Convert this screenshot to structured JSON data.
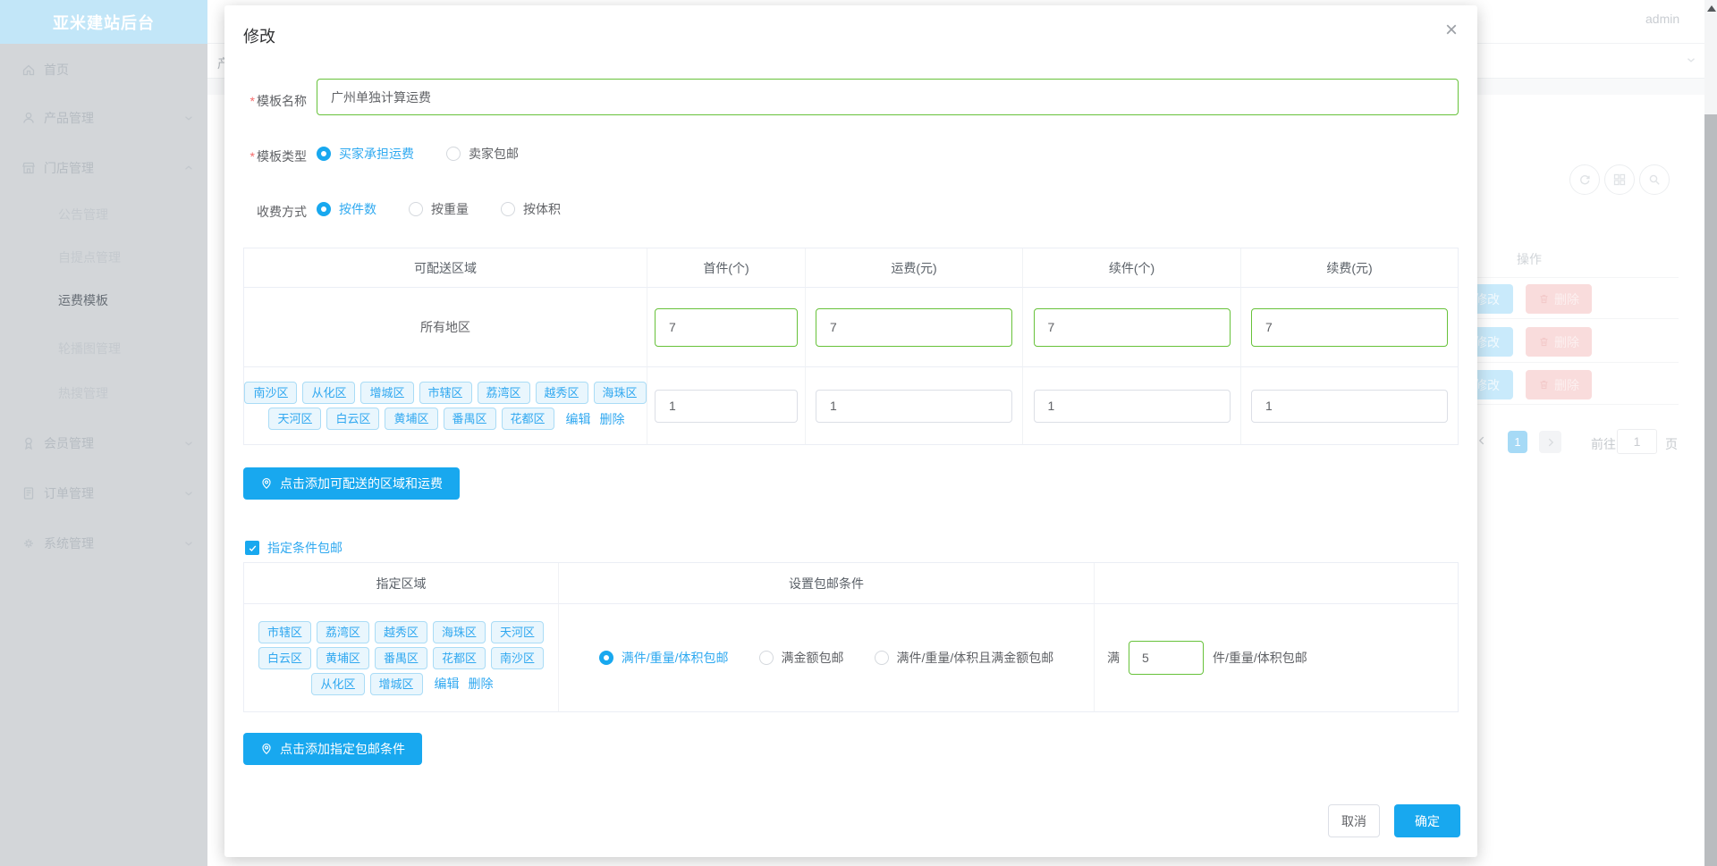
{
  "colors": {
    "primary_blue": "#18a8ef",
    "success_green": "#67c23a",
    "tag_text_blue": "#30a8f0",
    "required_red": "#f56c6c",
    "sidebar_title_bg": "#c2e6f8"
  },
  "icons": {
    "location": "location-pin-icon",
    "home": "home-icon",
    "user": "user-icon",
    "shop": "shop-icon",
    "badge": "badge-icon",
    "order": "order-icon",
    "gear": "gear-icon",
    "refresh": "refresh-icon",
    "grid": "grid-icon",
    "search": "search-icon",
    "trash": "trash-icon",
    "check": "check-icon",
    "close": "close-icon"
  },
  "sidebar": {
    "title": "亚米建站后台",
    "items": [
      {
        "label": "首页"
      },
      {
        "label": "产品管理"
      },
      {
        "label": "门店管理"
      },
      {
        "label": "公告管理"
      },
      {
        "label": "自提点管理"
      },
      {
        "label": "运费模板"
      },
      {
        "label": "轮播图管理"
      },
      {
        "label": "热搜管理"
      },
      {
        "label": "会员管理"
      },
      {
        "label": "订单管理"
      },
      {
        "label": "系统管理"
      }
    ]
  },
  "topbar": {
    "username": "admin",
    "breadcrumb_fragment": "产"
  },
  "background": {
    "actions_header": "操作",
    "rows": [
      {
        "edit": "修改",
        "delete": "删除"
      },
      {
        "edit": "修改",
        "delete": "删除"
      },
      {
        "edit": "修改",
        "delete": "删除"
      }
    ],
    "pagination": {
      "current": "1",
      "goto": "前往",
      "value": "1",
      "unit": "页"
    }
  },
  "modal": {
    "title": "修改",
    "close": "×",
    "required_marker": "*",
    "name": {
      "label": "模板名称",
      "value": "广州单独计算运费"
    },
    "type": {
      "label": "模板类型",
      "options": [
        "买家承担运费",
        "卖家包邮"
      ]
    },
    "charge": {
      "label": "收费方式",
      "options": [
        "按件数",
        "按重量",
        "按体积"
      ]
    },
    "table1": {
      "headers": [
        "可配送区域",
        "首件(个)",
        "运费(元)",
        "续件(个)",
        "续费(元)"
      ],
      "row1": {
        "region": "所有地区",
        "v1": "7",
        "v2": "7",
        "v3": "7",
        "v4": "7"
      },
      "row2": {
        "tags": [
          "南沙区",
          "从化区",
          "增城区",
          "市辖区",
          "荔湾区",
          "越秀区",
          "海珠区",
          "天河区",
          "白云区",
          "黄埔区",
          "番禺区",
          "花都区"
        ],
        "edit": "编辑",
        "delete": "删除",
        "v1": "1",
        "v2": "1",
        "v3": "1",
        "v4": "1"
      }
    },
    "add_region": "点击添加可配送的区域和运费",
    "condition_checkbox": "指定条件包邮",
    "table2": {
      "headers": [
        "指定区域",
        "设置包邮条件"
      ],
      "tags": [
        "市辖区",
        "荔湾区",
        "越秀区",
        "海珠区",
        "天河区",
        "白云区",
        "黄埔区",
        "番禺区",
        "花都区",
        "南沙区",
        "从化区",
        "增城区"
      ],
      "edit": "编辑",
      "delete": "删除",
      "options": [
        "满件/重量/体积包邮",
        "满金额包邮",
        "满件/重量/体积且满金额包邮"
      ],
      "threshold": {
        "prefix": "满",
        "value": "5",
        "suffix": "件/重量/体积包邮"
      }
    },
    "add_condition": "点击添加指定包邮条件",
    "cancel": "取消",
    "confirm": "确定"
  }
}
